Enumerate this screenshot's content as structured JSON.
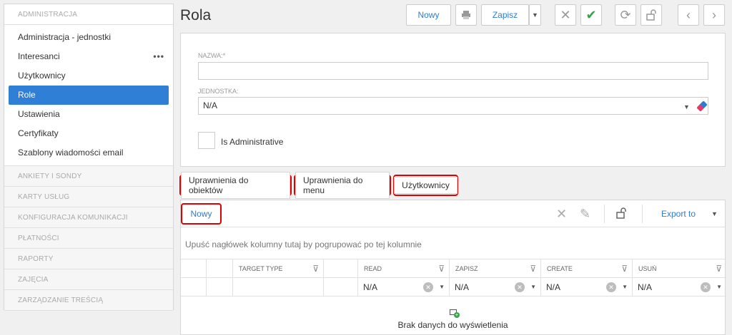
{
  "sidebar": {
    "admin_header": "ADMINISTRACJA",
    "items": [
      {
        "label": "Administracja - jednostki"
      },
      {
        "label": "Interesanci",
        "more": "•••"
      },
      {
        "label": "Użytkownicy"
      },
      {
        "label": "Role"
      },
      {
        "label": "Ustawienia"
      },
      {
        "label": "Certyfikaty"
      },
      {
        "label": "Szablony wiadomości email"
      }
    ],
    "sections": [
      "ANKIETY I SONDY",
      "KARTY USŁUG",
      "KONFIGURACJA KOMUNIKACJI",
      "PŁATNOŚCI",
      "RAPORTY",
      "ZAJĘCIA",
      "ZARZĄDZANIE TREŚCIĄ"
    ]
  },
  "header": {
    "title": "Rola",
    "new_label": "Nowy",
    "save_label": "Zapisz"
  },
  "form": {
    "name_label": "NAZWA:*",
    "name_value": "",
    "unit_label": "JEDNOSTKA:",
    "unit_value": "N/A",
    "admin_label": "Is Administrative"
  },
  "tabs": [
    "Uprawnienia do obiektów",
    "Uprawnienia do menu",
    "Użytkownicy"
  ],
  "grid": {
    "new_label": "Nowy",
    "export_label": "Export to",
    "group_hint": "Upuść nagłówek kolumny tutaj by pogrupować po tej kolumnie",
    "columns": [
      "TARGET TYPE",
      "READ",
      "ZAPISZ",
      "CREATE",
      "USUŃ"
    ],
    "filter_value": "N/A",
    "no_data": "Brak danych do wyświetlenia"
  },
  "colors": {
    "accent": "#2f7fd6",
    "highlight": "#e00000",
    "ok": "#3aa24a"
  }
}
